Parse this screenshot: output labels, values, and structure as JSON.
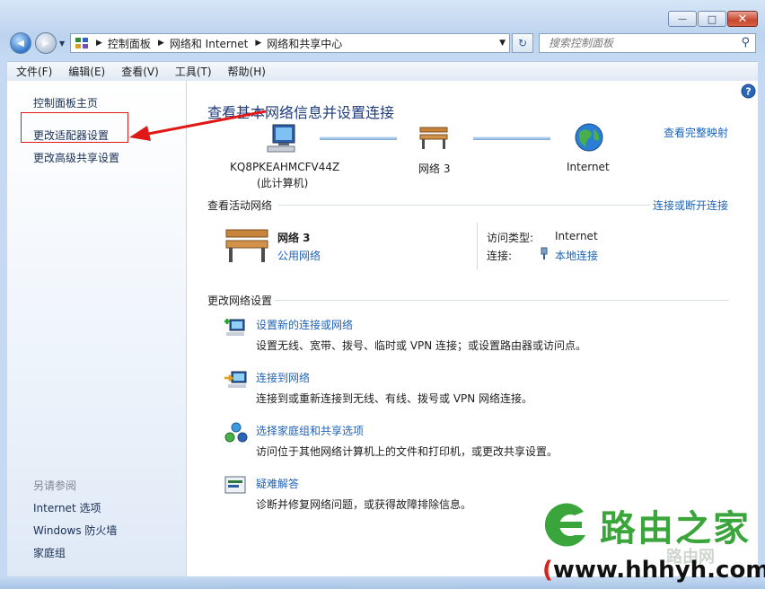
{
  "window": {
    "min_glyph": "—",
    "max_glyph": "□",
    "close_glyph": "✕"
  },
  "nav": {
    "back_glyph": "◀",
    "forward_glyph": "▶",
    "history_glyph": "▼",
    "address": [
      "控制面板",
      "网络和 Internet",
      "网络和共享中心"
    ],
    "refresh_glyph": "↻",
    "search_placeholder": "搜索控制面板"
  },
  "menu": [
    "文件(F)",
    "编辑(E)",
    "查看(V)",
    "工具(T)",
    "帮助(H)"
  ],
  "sidebar": {
    "home": "控制面板主页",
    "adapter": "更改适配器设置",
    "advanced": "更改高级共享设置",
    "see_also": "另请参阅",
    "see_also_items": [
      "Internet 选项",
      "Windows 防火墙",
      "家庭组"
    ]
  },
  "main": {
    "title": "查看基本网络信息并设置连接",
    "view_full_map": "查看完整映射",
    "map": {
      "computer_name": "KQ8PKEAHMCFV44Z",
      "computer_sub": "(此计算机)",
      "network_name": "网络  3",
      "internet_label": "Internet"
    },
    "active_section": "查看活动网络",
    "connect_disconnect": "连接或断开连接",
    "active": {
      "name": "网络  3",
      "type": "公用网络",
      "access_label": "访问类型:",
      "access_value": "Internet",
      "conn_label": "连接:",
      "conn_value": "本地连接"
    },
    "change_section": "更改网络设置",
    "items": [
      {
        "title": "设置新的连接或网络",
        "desc": "设置无线、宽带、拨号、临时或 VPN 连接；或设置路由器或访问点。"
      },
      {
        "title": "连接到网络",
        "desc": "连接到或重新连接到无线、有线、拨号或 VPN 网络连接。"
      },
      {
        "title": "选择家庭组和共享选项",
        "desc": "访问位于其他网络计算机上的文件和打印机，或更改共享设置。"
      },
      {
        "title": "疑难解答",
        "desc": "诊断并修复网络问题，或获得故障排除信息。"
      }
    ]
  },
  "watermark": {
    "name": "路由之家",
    "url_open": "(",
    "url": "www.hhhyh.com",
    "url_close": ")",
    "sub": "路由网"
  }
}
